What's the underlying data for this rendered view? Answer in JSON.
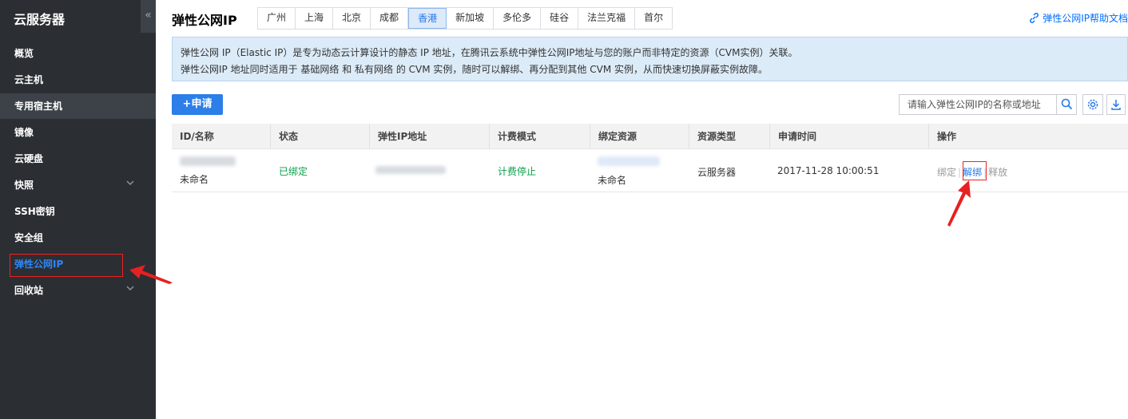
{
  "sidebar": {
    "title": "云服务器",
    "collapse_label": "«",
    "items": [
      {
        "label": "概览"
      },
      {
        "label": "云主机"
      },
      {
        "label": "专用宿主机"
      },
      {
        "label": "镜像"
      },
      {
        "label": "云硬盘"
      },
      {
        "label": "快照"
      },
      {
        "label": "SSH密钥"
      },
      {
        "label": "安全组"
      },
      {
        "label": "弹性公网IP"
      },
      {
        "label": "回收站"
      }
    ]
  },
  "header": {
    "title": "弹性公网IP",
    "regions": [
      "广州",
      "上海",
      "北京",
      "成都",
      "香港",
      "新加坡",
      "多伦多",
      "硅谷",
      "法兰克福",
      "首尔"
    ],
    "selected_region": "香港",
    "help_link": "弹性公网IP帮助文档"
  },
  "notice": {
    "line1": "弹性公网 IP（Elastic IP）是专为动态云计算设计的静态 IP 地址，在腾讯云系统中弹性公网IP地址与您的账户而非特定的资源（CVM实例）关联。",
    "line2": "弹性公网IP 地址同时适用于 基础网络 和 私有网络 的 CVM 实例，随时可以解绑、再分配到其他 CVM 实例，从而快速切换屏蔽实例故障。"
  },
  "toolbar": {
    "apply_label": "+申请",
    "search_placeholder": "请输入弹性公网IP的名称或地址"
  },
  "table": {
    "columns": [
      "ID/名称",
      "状态",
      "弹性IP地址",
      "计费模式",
      "绑定资源",
      "资源类型",
      "申请时间",
      "操作"
    ],
    "rows": [
      {
        "name": "未命名",
        "status": "已绑定",
        "billing": "计费停止",
        "resource_name": "未命名",
        "resource_type": "云服务器",
        "created": "2017-11-28 10:00:51",
        "actions": [
          "绑定",
          "解绑",
          "释放"
        ]
      }
    ]
  },
  "colors": {
    "sidebar_bg": "#2b2f33",
    "accent": "#2c7ee8",
    "status_green": "#0aa04a",
    "highlight_red": "#e22"
  }
}
